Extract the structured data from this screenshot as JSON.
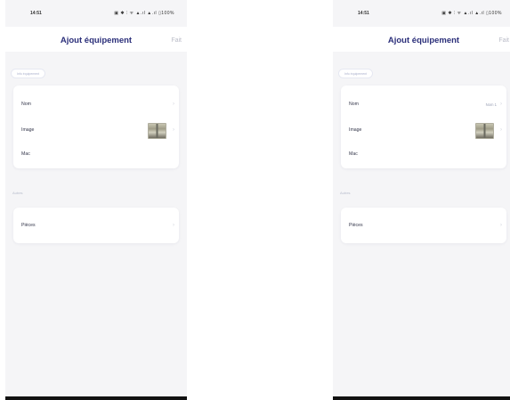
{
  "status_bar": {
    "time": "14:51",
    "icons": "▣ ✱ ⫶ ᯤ ▲.ıl ▲.ıl ▯100%"
  },
  "nav": {
    "title": "Ajout équipement",
    "action_label": "Fait"
  },
  "sections": {
    "equipment_info": "Info équipement",
    "others": "Autres"
  },
  "rows": {
    "name": "Nom",
    "image": "Image",
    "mac": "Mac",
    "rooms": "Pièces"
  },
  "right_screen": {
    "name_value": "Nom 1"
  },
  "icons": {
    "chevron": "›"
  },
  "colors": {
    "title": "#2b2f7a",
    "action_disabled": "#b9bbc7",
    "background": "#f5f5f7"
  }
}
